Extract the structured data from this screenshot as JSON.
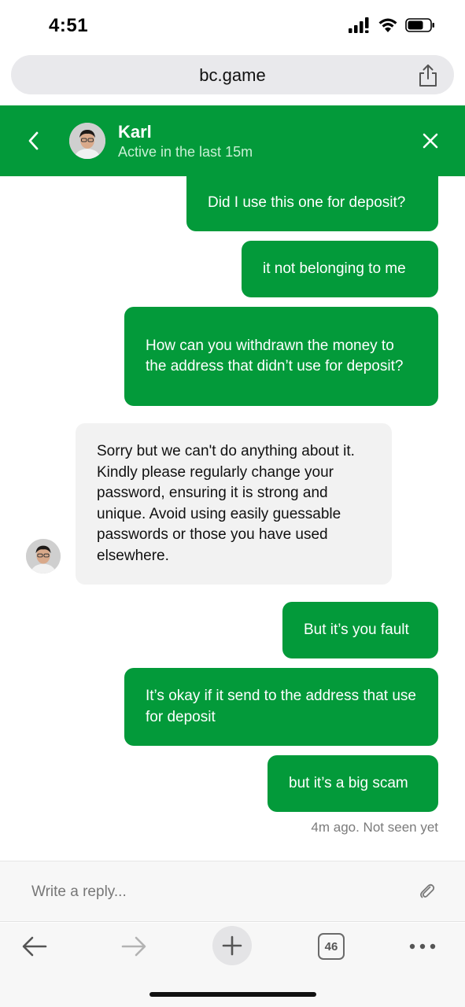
{
  "status_bar": {
    "time": "4:51",
    "icons": [
      "cellular-signal-icon",
      "wifi-icon",
      "battery-icon"
    ]
  },
  "url_bar": {
    "url": "bc.game",
    "share_icon": "share-icon"
  },
  "chat_header": {
    "name": "Karl",
    "status": "Active in the last 15m",
    "back_icon": "chevron-left-icon",
    "close_icon": "close-icon",
    "color": "#039a3a"
  },
  "messages": [
    {
      "from": "me",
      "text": "Did I use this one for deposit?"
    },
    {
      "from": "me",
      "text": "it not belonging to me"
    },
    {
      "from": "me",
      "text": "How can you withdrawn the money to the address that didn’t use for deposit?"
    },
    {
      "from": "agent",
      "text": "Sorry but we can't do anything about it. Kindly please regularly change your password, ensuring it is strong and unique. Avoid using easily guessable passwords or those you have used elsewhere."
    },
    {
      "from": "me",
      "text": "But it’s you fault"
    },
    {
      "from": "me",
      "text": "It’s okay if it send to the address that use for deposit"
    },
    {
      "from": "me",
      "text": "but it’s a big scam"
    }
  ],
  "message_meta": "4m ago. Not seen yet",
  "reply": {
    "placeholder": "Write a reply...",
    "attach_icon": "paperclip-icon"
  },
  "toolbar": {
    "tab_count": "46",
    "icons": [
      "back-arrow-icon",
      "forward-arrow-icon",
      "plus-icon",
      "tabs-icon",
      "more-icon"
    ]
  }
}
